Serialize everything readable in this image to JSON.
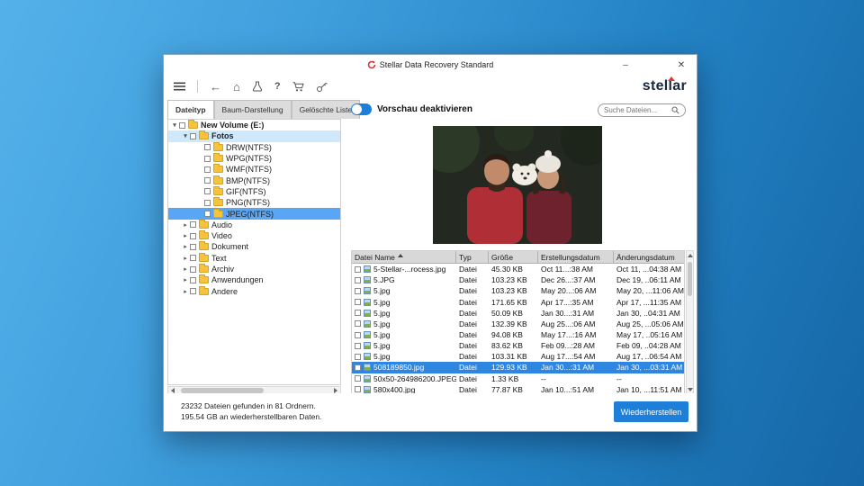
{
  "window": {
    "title": "Stellar Data Recovery Standard",
    "minimize_glyph": "–",
    "close_glyph": "✕"
  },
  "toolbar": {
    "back_glyph": "←",
    "home_glyph": "⌂",
    "help_glyph": "?",
    "logo_text": "stellar",
    "accent_color": "#e03a30"
  },
  "tabs": [
    {
      "label": "Dateityp",
      "active": true
    },
    {
      "label": "Baum-Darstellung",
      "active": false
    },
    {
      "label": "Gelöschte Liste",
      "active": false
    }
  ],
  "preview_toggle": {
    "label": "Vorschau deaktivieren",
    "state": "on",
    "color": "#1d7fd8"
  },
  "search": {
    "placeholder": "Suche Dateien..."
  },
  "tree": {
    "items": [
      {
        "label": "New Volume (E:)",
        "chevron": "▾"
      },
      {
        "label": "Fotos",
        "chevron": "▾"
      },
      {
        "label": "DRW(NTFS)",
        "chevron": ""
      },
      {
        "label": "WPG(NTFS)",
        "chevron": ""
      },
      {
        "label": "WMF(NTFS)",
        "chevron": ""
      },
      {
        "label": "BMP(NTFS)",
        "chevron": ""
      },
      {
        "label": "GIF(NTFS)",
        "chevron": ""
      },
      {
        "label": "PNG(NTFS)",
        "chevron": ""
      },
      {
        "label": "JPEG(NTFS)",
        "chevron": ""
      },
      {
        "label": "Audio",
        "chevron": "▸"
      },
      {
        "label": "Video",
        "chevron": "▸"
      },
      {
        "label": "Dokument",
        "chevron": "▸"
      },
      {
        "label": "Text",
        "chevron": "▸"
      },
      {
        "label": "Archiv",
        "chevron": "▸"
      },
      {
        "label": "Anwendungen",
        "chevron": "▸"
      },
      {
        "label": "Andere",
        "chevron": "▸"
      }
    ],
    "selected_item": "JPEG(NTFS)",
    "selection_color": "#58a6f5"
  },
  "table": {
    "columns": [
      "Datei Name",
      "Typ",
      "Größe",
      "Erstellungsdatum",
      "Änderungsdatum"
    ],
    "rows": [
      {
        "name": "5-Stellar-...rocess.jpg",
        "type": "Datei",
        "size": "45.30 KB",
        "created": "Oct 11...:38 AM",
        "modified": "Oct 11, ...04:38 AM"
      },
      {
        "name": "5.JPG",
        "type": "Datei",
        "size": "103.23 KB",
        "created": "Dec 26...:37 AM",
        "modified": "Dec 19, ..06:11 AM"
      },
      {
        "name": "5.jpg",
        "type": "Datei",
        "size": "103.23 KB",
        "created": "May 20...:06 AM",
        "modified": "May 20, ...11:06 AM"
      },
      {
        "name": "5.jpg",
        "type": "Datei",
        "size": "171.65 KB",
        "created": "Apr 17...:35 AM",
        "modified": "Apr 17, ...11:35 AM"
      },
      {
        "name": "5.jpg",
        "type": "Datei",
        "size": "50.09 KB",
        "created": "Jan 30...:31 AM",
        "modified": "Jan 30, ..04:31 AM"
      },
      {
        "name": "5.jpg",
        "type": "Datei",
        "size": "132.39 KB",
        "created": "Aug 25...:06 AM",
        "modified": "Aug 25, ...05:06 AM"
      },
      {
        "name": "5.jpg",
        "type": "Datei",
        "size": "94.08 KB",
        "created": "May 17...:16 AM",
        "modified": "May 17, ..05:16 AM"
      },
      {
        "name": "5.jpg",
        "type": "Datei",
        "size": "83.62 KB",
        "created": "Feb 09...:28 AM",
        "modified": "Feb 09, ..04:28 AM"
      },
      {
        "name": "5.jpg",
        "type": "Datei",
        "size": "103.31 KB",
        "created": "Aug 17...:54 AM",
        "modified": "Aug 17, ..06:54 AM"
      },
      {
        "name": "508189850.jpg",
        "type": "Datei",
        "size": "129.93 KB",
        "created": "Jan 30...:31 AM",
        "modified": "Jan 30, ...03:31 AM",
        "selected": true
      },
      {
        "name": "50x50-264986200.JPEG",
        "type": "Datei",
        "size": "1.33 KB",
        "created": "--",
        "modified": "--"
      },
      {
        "name": "580x400.jpg",
        "type": "Datei",
        "size": "77.87 KB",
        "created": "Jan 10...:51 AM",
        "modified": "Jan 10, ...11:51 AM"
      }
    ],
    "selected_row_color": "#2e86e0"
  },
  "status": {
    "line1": "23232 Dateien gefunden in 81 Ordnern.",
    "line2": "195.54 GB an wiederherstellbaren Daten."
  },
  "recover_button": {
    "label": "Wiederherstellen",
    "color": "#1e7fd8"
  }
}
